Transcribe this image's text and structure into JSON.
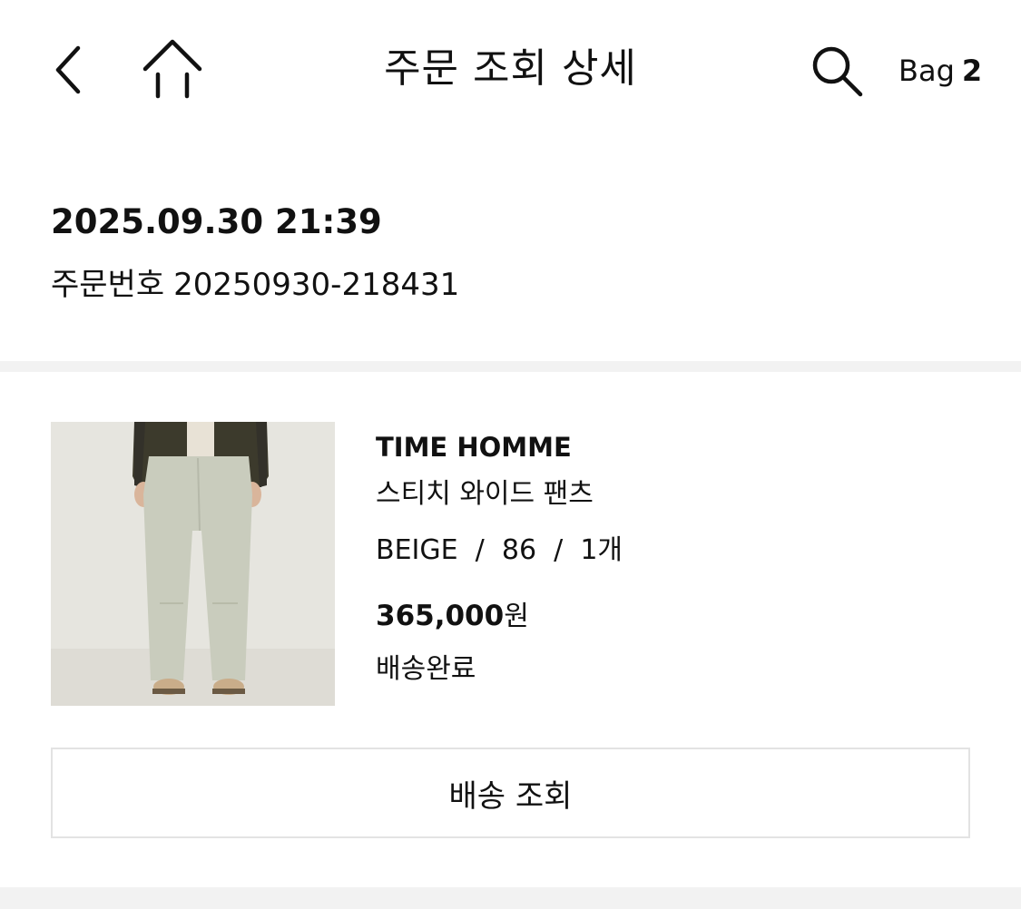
{
  "header": {
    "title": "주문 조회 상세",
    "bag_label": "Bag",
    "bag_count": "2",
    "icons": [
      "back-chevron-icon",
      "home-icon",
      "search-icon"
    ]
  },
  "order": {
    "date": "2025.09.30 21:39",
    "number_label": "주문번호",
    "number": "20250930-218431"
  },
  "product": {
    "brand": "TIME HOMME",
    "name": "스티치 와이드 팬츠",
    "color": "BEIGE",
    "size": "86",
    "quantity": "1개",
    "price": "365,000",
    "currency": "원",
    "status": "배송완료"
  },
  "actions": {
    "track_label": "배송 조회"
  },
  "colors": {
    "text": "#111111",
    "divider": "#f2f2f2",
    "button_border": "#e3e3e3",
    "pants": "#c9ccbd",
    "jacket": "#3c3a2c"
  }
}
